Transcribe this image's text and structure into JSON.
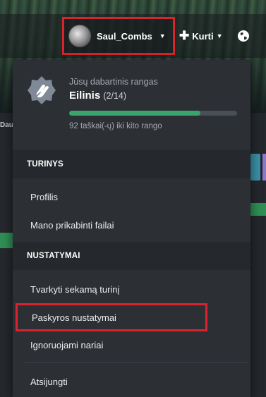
{
  "navbar": {
    "username": "Saul_Combs",
    "create_label": "Kurti",
    "icons": {
      "user_caret": "chevron-down-icon",
      "create": "plus-icon",
      "globe": "globe-icon"
    }
  },
  "background": {
    "left_label": "Dau"
  },
  "rank": {
    "caption": "Jūsų dabartinis rangas",
    "name": "Eilinis",
    "count": "(2/14)",
    "progress": 0.78,
    "points_text": "92 taškai(-ų) iki kito rango",
    "badge_icon": "waving-hand-badge-icon"
  },
  "sections": {
    "content": {
      "title": "TURINYS",
      "items": [
        "Profilis",
        "Mano prikabinti failai"
      ]
    },
    "settings": {
      "title": "NUSTATYMAI",
      "items": [
        "Tvarkyti sekamą turinį",
        "Paskyros nustatymai",
        "Ignoruojami nariai"
      ]
    }
  },
  "logout_label": "Atsijungti",
  "colors": {
    "accent_green": "#3aa46c",
    "annotation_red": "#d9232d",
    "menu_bg": "#2c2f34"
  }
}
